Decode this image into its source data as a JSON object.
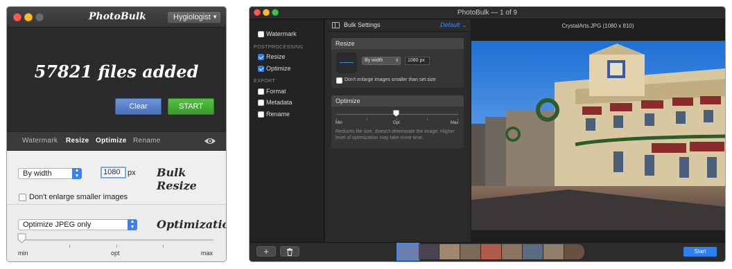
{
  "left_window": {
    "app_title": "PhotoBulk",
    "profile_select": "Hygiologist",
    "files_added": "57821 files added",
    "clear_button": "Clear",
    "start_button": "START",
    "tabs": [
      {
        "label": "Watermark",
        "active": false
      },
      {
        "label": "Resize",
        "active": true
      },
      {
        "label": "Optimize",
        "active": true
      },
      {
        "label": "Rename",
        "active": false
      }
    ],
    "resize": {
      "mode": "By width",
      "value": "1080",
      "unit": "px",
      "section_title": "Bulk Resize",
      "dont_enlarge_label": "Don't enlarge smaller images",
      "dont_enlarge_checked": false
    },
    "optimization": {
      "mode": "Optimize JPEG only",
      "section_title": "Optimization",
      "slider_min": "min",
      "slider_opt": "opt",
      "slider_max": "max",
      "slider_level": 0
    }
  },
  "right_window": {
    "title": "PhotoBulk — 1 of 9",
    "sidebar": {
      "items": [
        {
          "label": "Watermark",
          "checked": false
        },
        {
          "section": "POSTPROCESSING"
        },
        {
          "label": "Resize",
          "checked": true
        },
        {
          "label": "Optimize",
          "checked": true
        },
        {
          "section": "EXPORT"
        },
        {
          "label": "Format",
          "checked": false
        },
        {
          "label": "Metadata",
          "checked": false
        },
        {
          "label": "Rename",
          "checked": false
        }
      ]
    },
    "settings_title": "Bulk Settings",
    "preset": "Default",
    "resize_card": {
      "title": "Resize",
      "mode": "By width",
      "value": "1080 px",
      "dont_enlarge_label": "Don't enlarge images smaller than set size",
      "dont_enlarge_checked": false
    },
    "optimize_card": {
      "title": "Optimize",
      "slider_min": "Min",
      "slider_opt": "Opt",
      "slider_max": "Max",
      "slider_level": 0.5,
      "description": "Reduces file size, doesn't deteriorate the image. Higher level of optimization may take more time."
    },
    "file_name": "CrystalArts.JPG (1080 x 810)",
    "add_button": "+",
    "delete_icon": "trash-icon",
    "start_button": "Start",
    "thumbnail_count": 9,
    "colors": {
      "accent": "#2d7ff6",
      "start_green": "#3fa832"
    }
  }
}
